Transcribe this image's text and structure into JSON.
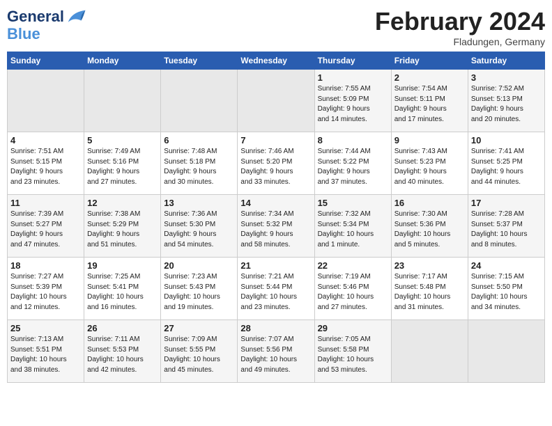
{
  "header": {
    "logo_line1": "General",
    "logo_line2": "Blue",
    "month_title": "February 2024",
    "location": "Fladungen, Germany"
  },
  "weekdays": [
    "Sunday",
    "Monday",
    "Tuesday",
    "Wednesday",
    "Thursday",
    "Friday",
    "Saturday"
  ],
  "weeks": [
    [
      {
        "day": "",
        "info": ""
      },
      {
        "day": "",
        "info": ""
      },
      {
        "day": "",
        "info": ""
      },
      {
        "day": "",
        "info": ""
      },
      {
        "day": "1",
        "info": "Sunrise: 7:55 AM\nSunset: 5:09 PM\nDaylight: 9 hours\nand 14 minutes."
      },
      {
        "day": "2",
        "info": "Sunrise: 7:54 AM\nSunset: 5:11 PM\nDaylight: 9 hours\nand 17 minutes."
      },
      {
        "day": "3",
        "info": "Sunrise: 7:52 AM\nSunset: 5:13 PM\nDaylight: 9 hours\nand 20 minutes."
      }
    ],
    [
      {
        "day": "4",
        "info": "Sunrise: 7:51 AM\nSunset: 5:15 PM\nDaylight: 9 hours\nand 23 minutes."
      },
      {
        "day": "5",
        "info": "Sunrise: 7:49 AM\nSunset: 5:16 PM\nDaylight: 9 hours\nand 27 minutes."
      },
      {
        "day": "6",
        "info": "Sunrise: 7:48 AM\nSunset: 5:18 PM\nDaylight: 9 hours\nand 30 minutes."
      },
      {
        "day": "7",
        "info": "Sunrise: 7:46 AM\nSunset: 5:20 PM\nDaylight: 9 hours\nand 33 minutes."
      },
      {
        "day": "8",
        "info": "Sunrise: 7:44 AM\nSunset: 5:22 PM\nDaylight: 9 hours\nand 37 minutes."
      },
      {
        "day": "9",
        "info": "Sunrise: 7:43 AM\nSunset: 5:23 PM\nDaylight: 9 hours\nand 40 minutes."
      },
      {
        "day": "10",
        "info": "Sunrise: 7:41 AM\nSunset: 5:25 PM\nDaylight: 9 hours\nand 44 minutes."
      }
    ],
    [
      {
        "day": "11",
        "info": "Sunrise: 7:39 AM\nSunset: 5:27 PM\nDaylight: 9 hours\nand 47 minutes."
      },
      {
        "day": "12",
        "info": "Sunrise: 7:38 AM\nSunset: 5:29 PM\nDaylight: 9 hours\nand 51 minutes."
      },
      {
        "day": "13",
        "info": "Sunrise: 7:36 AM\nSunset: 5:30 PM\nDaylight: 9 hours\nand 54 minutes."
      },
      {
        "day": "14",
        "info": "Sunrise: 7:34 AM\nSunset: 5:32 PM\nDaylight: 9 hours\nand 58 minutes."
      },
      {
        "day": "15",
        "info": "Sunrise: 7:32 AM\nSunset: 5:34 PM\nDaylight: 10 hours\nand 1 minute."
      },
      {
        "day": "16",
        "info": "Sunrise: 7:30 AM\nSunset: 5:36 PM\nDaylight: 10 hours\nand 5 minutes."
      },
      {
        "day": "17",
        "info": "Sunrise: 7:28 AM\nSunset: 5:37 PM\nDaylight: 10 hours\nand 8 minutes."
      }
    ],
    [
      {
        "day": "18",
        "info": "Sunrise: 7:27 AM\nSunset: 5:39 PM\nDaylight: 10 hours\nand 12 minutes."
      },
      {
        "day": "19",
        "info": "Sunrise: 7:25 AM\nSunset: 5:41 PM\nDaylight: 10 hours\nand 16 minutes."
      },
      {
        "day": "20",
        "info": "Sunrise: 7:23 AM\nSunset: 5:43 PM\nDaylight: 10 hours\nand 19 minutes."
      },
      {
        "day": "21",
        "info": "Sunrise: 7:21 AM\nSunset: 5:44 PM\nDaylight: 10 hours\nand 23 minutes."
      },
      {
        "day": "22",
        "info": "Sunrise: 7:19 AM\nSunset: 5:46 PM\nDaylight: 10 hours\nand 27 minutes."
      },
      {
        "day": "23",
        "info": "Sunrise: 7:17 AM\nSunset: 5:48 PM\nDaylight: 10 hours\nand 31 minutes."
      },
      {
        "day": "24",
        "info": "Sunrise: 7:15 AM\nSunset: 5:50 PM\nDaylight: 10 hours\nand 34 minutes."
      }
    ],
    [
      {
        "day": "25",
        "info": "Sunrise: 7:13 AM\nSunset: 5:51 PM\nDaylight: 10 hours\nand 38 minutes."
      },
      {
        "day": "26",
        "info": "Sunrise: 7:11 AM\nSunset: 5:53 PM\nDaylight: 10 hours\nand 42 minutes."
      },
      {
        "day": "27",
        "info": "Sunrise: 7:09 AM\nSunset: 5:55 PM\nDaylight: 10 hours\nand 45 minutes."
      },
      {
        "day": "28",
        "info": "Sunrise: 7:07 AM\nSunset: 5:56 PM\nDaylight: 10 hours\nand 49 minutes."
      },
      {
        "day": "29",
        "info": "Sunrise: 7:05 AM\nSunset: 5:58 PM\nDaylight: 10 hours\nand 53 minutes."
      },
      {
        "day": "",
        "info": ""
      },
      {
        "day": "",
        "info": ""
      }
    ]
  ]
}
